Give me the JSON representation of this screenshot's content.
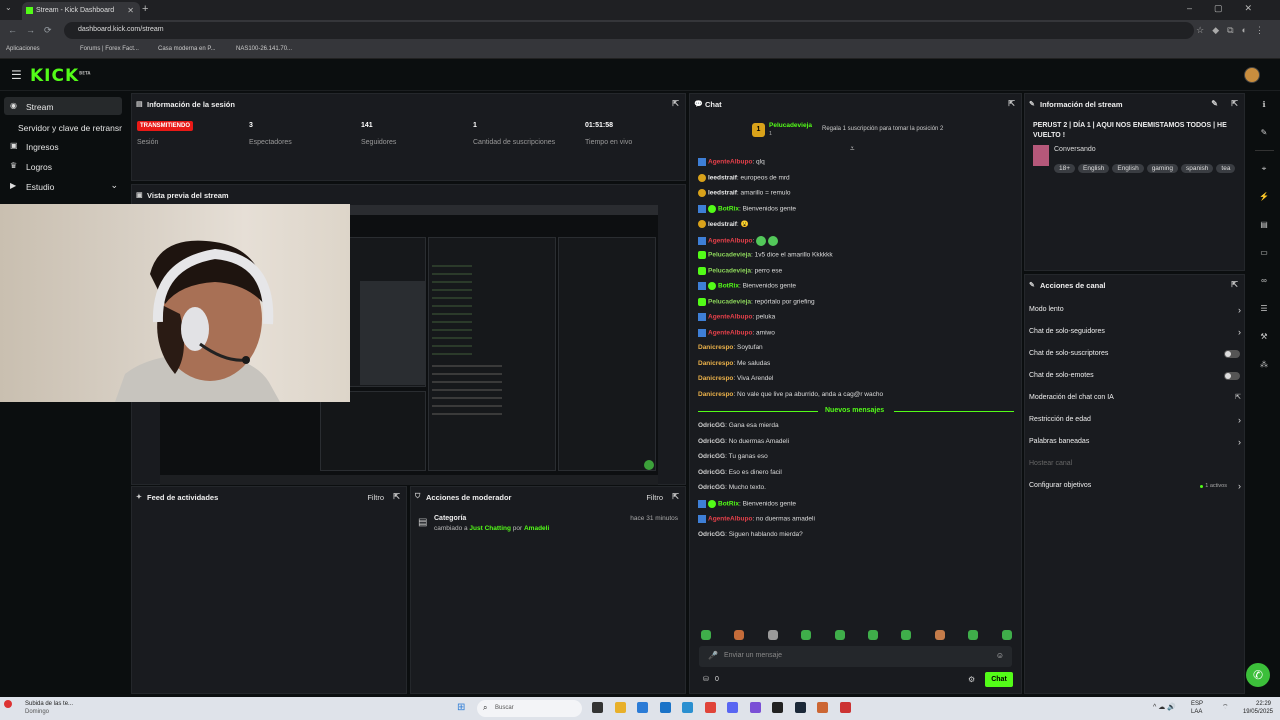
{
  "browser": {
    "tab_title": "Stream - Kick Dashboard",
    "url": "dashboard.kick.com/stream",
    "bookmarks": [
      "Aplicaciones",
      "Forums | Forex Fact...",
      "Casa moderna en P...",
      "NAS100-26.141.70..."
    ]
  },
  "header": {
    "logo": "KICK",
    "logo_sup": "BETA"
  },
  "sidebar": {
    "items": [
      {
        "label": "Stream",
        "icon": "broadcast-icon"
      },
      {
        "label": "Servidor y clave de retransmisión",
        "icon": ""
      },
      {
        "label": "Ingresos",
        "icon": "wallet-icon"
      },
      {
        "label": "Logros",
        "icon": "trophy-icon"
      },
      {
        "label": "Estudio",
        "icon": "video-icon"
      }
    ]
  },
  "session": {
    "title": "Información de la sesión",
    "status": "TRANSMITIENDO",
    "status_label": "Sesión",
    "stats": [
      {
        "value": "3",
        "label": "Espectadores"
      },
      {
        "value": "141",
        "label": "Seguidores"
      },
      {
        "value": "1",
        "label": "Cantidad de suscripciones"
      },
      {
        "value": "01:51:58",
        "label": "Tiempo en vivo"
      }
    ]
  },
  "preview": {
    "title": "Vista previa del stream"
  },
  "activity": {
    "title": "Feed de actividades",
    "filter": "Filtro"
  },
  "modactions": {
    "title": "Acciones de moderador",
    "filter": "Filtro",
    "item_title": "Categoría",
    "item_time": "hace 31 minutos",
    "item_pre": "cambiado a",
    "item_category": "Just Chatting",
    "item_mid": "por",
    "item_user": "Amadeli"
  },
  "chat": {
    "title": "Chat",
    "pinned_user": "Pelucadevieja",
    "pinned_sub": "1",
    "pinned_text": "Regala 1 suscripción para tomar la posición 2",
    "messages": [
      {
        "user": "AgenteAlbupo",
        "text": ": qlq",
        "color": "#e5404a",
        "badge": "bot"
      },
      {
        "user": "leedstraif",
        "text": ": europeos de mrd",
        "color": "#e8e8e8",
        "badge": "yellow"
      },
      {
        "user": "leedstraif",
        "text": ": amarillo = remulo",
        "color": "#e8e8e8",
        "badge": "yellow"
      },
      {
        "user": "BotRix",
        "text": ": Bienvenidos gente",
        "color": "#53fc18",
        "badge": "botv"
      },
      {
        "user": "leedstraif",
        "text": ": 😮",
        "color": "#e8e8e8",
        "badge": "yellow"
      },
      {
        "user": "AgenteAlbupo",
        "text": ":",
        "color": "#e5404a",
        "badge": "bot",
        "emotes": 2
      },
      {
        "user": "Pelucadevieja",
        "text": ": 1v5 dice el amarillo Kkkkkk",
        "color": "#8bd35a",
        "badge": "green"
      },
      {
        "user": "Pelucadevieja",
        "text": ": perro ese",
        "color": "#8bd35a",
        "badge": "green"
      },
      {
        "user": "BotRix",
        "text": ": Bienvenidos gente",
        "color": "#53fc18",
        "badge": "botv"
      },
      {
        "user": "Pelucadevieja",
        "text": ": repórtalo por griefing",
        "color": "#8bd35a",
        "badge": "green"
      },
      {
        "user": "AgenteAlbupo",
        "text": ": peluka",
        "color": "#e5404a",
        "badge": "bot"
      },
      {
        "user": "AgenteAlbupo",
        "text": ": amiwo",
        "color": "#e5404a",
        "badge": "bot"
      },
      {
        "user": "Danicrespo",
        "text": ": Soytufan",
        "color": "#e9b04a",
        "badge": ""
      },
      {
        "user": "Danicrespo",
        "text": ": Me saludas",
        "color": "#e9b04a",
        "badge": ""
      },
      {
        "user": "Danicrespo",
        "text": ": Viva Arendel",
        "color": "#e9b04a",
        "badge": ""
      },
      {
        "user": "Danicrespo",
        "text": ": No vale que live pa aburrido, anda a cag@r wacho",
        "color": "#e9b04a",
        "badge": ""
      }
    ],
    "new_messages_label": "Nuevos mensajes",
    "new_messages": [
      {
        "user": "OdricGG",
        "text": ": Gana esa mierda",
        "color": "#cfcfcf",
        "badge": ""
      },
      {
        "user": "OdricGG",
        "text": ": No duermas Amadeli",
        "color": "#cfcfcf",
        "badge": ""
      },
      {
        "user": "OdricGG",
        "text": ": Tu ganas eso",
        "color": "#cfcfcf",
        "badge": ""
      },
      {
        "user": "OdricGG",
        "text": ": Eso es dinero facil",
        "color": "#cfcfcf",
        "badge": ""
      },
      {
        "user": "OdricGG",
        "text": ": Mucho texto.",
        "color": "#cfcfcf",
        "badge": ""
      },
      {
        "user": "BotRix",
        "text": ": Bienvenidos gente",
        "color": "#53fc18",
        "badge": "botv"
      },
      {
        "user": "AgenteAlbupo",
        "text": ": no duermas amadeli",
        "color": "#e5404a",
        "badge": "bot"
      },
      {
        "user": "OdricGG",
        "text": ": Siguen hablando mierda?",
        "color": "#cfcfcf",
        "badge": ""
      }
    ],
    "input_placeholder": "Enviar un mensaje",
    "points": "0",
    "send_label": "Chat"
  },
  "stream_info": {
    "title": "Información del stream",
    "stream_title": "PERUST 2 | DÍA 1 | AQUI NOS ENEMISTAMOS TODOS | HE VUELTO !",
    "category": "Conversando",
    "tags": [
      "18+",
      "English",
      "English",
      "gaming",
      "spanish",
      "tea"
    ]
  },
  "channel_actions": {
    "title": "Acciones de canal",
    "items": [
      {
        "label": "Modo lento",
        "control": "chevron"
      },
      {
        "label": "Chat de solo-seguidores",
        "control": "chevron"
      },
      {
        "label": "Chat de solo-suscriptores",
        "control": "toggle"
      },
      {
        "label": "Chat de solo-emotes",
        "control": "toggle"
      },
      {
        "label": "Moderación del chat con IA",
        "control": "external"
      },
      {
        "label": "Restricción de edad",
        "control": "chevron"
      },
      {
        "label": "Palabras baneadas",
        "control": "chevron"
      },
      {
        "label": "Hostear canal",
        "control": "disabled"
      },
      {
        "label": "Configurar objetivos",
        "control": "chevron",
        "extra": "1 activos"
      }
    ]
  },
  "taskbar": {
    "notif_title": "Subida de las te...",
    "notif_sub": "Domingo",
    "search": "Buscar",
    "lang1": "ESP",
    "lang2": "LAA",
    "time": "22:29",
    "date": "19/05/2025"
  },
  "colors": {
    "accent": "#53fc18",
    "live": "#e91916",
    "panel": "#191b1f"
  }
}
